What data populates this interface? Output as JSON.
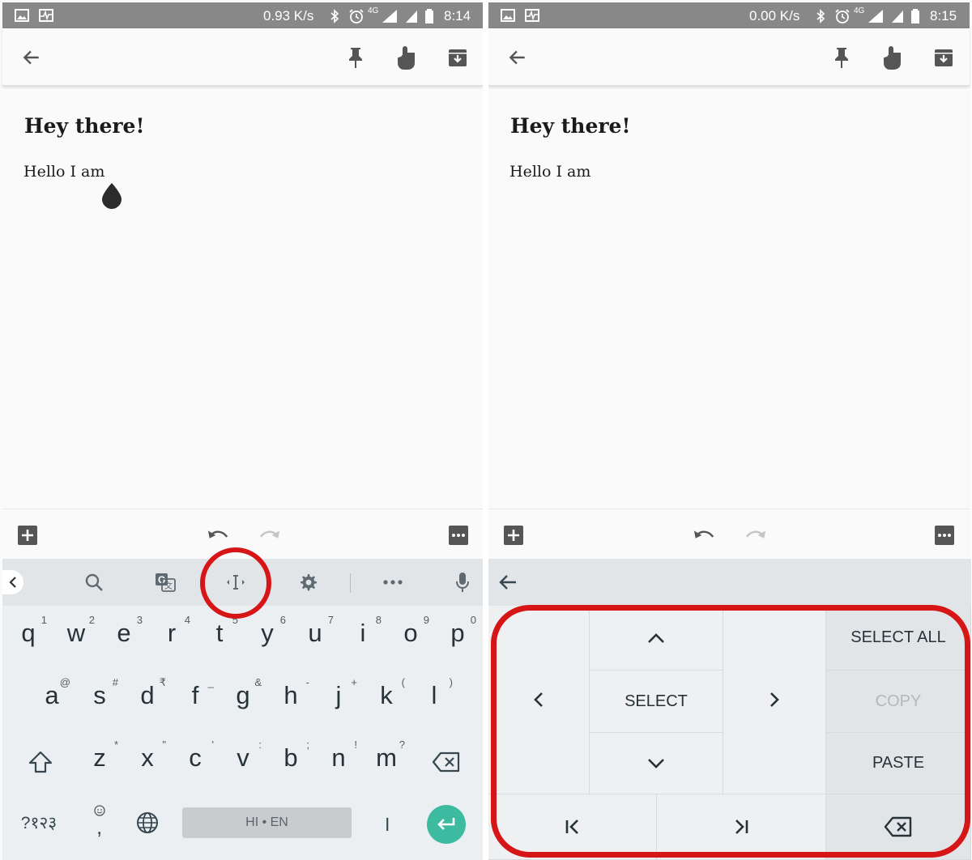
{
  "left_screen": {
    "status_bar": {
      "speed": "0.93 K/s",
      "network": "4G",
      "time": "8:14"
    },
    "note": {
      "title": "Hey there!",
      "body": "Hello I am"
    },
    "keyboard": {
      "row1": [
        {
          "key": "q",
          "hint": "1"
        },
        {
          "key": "w",
          "hint": "2"
        },
        {
          "key": "e",
          "hint": "3"
        },
        {
          "key": "r",
          "hint": "4"
        },
        {
          "key": "t",
          "hint": "5"
        },
        {
          "key": "y",
          "hint": "6"
        },
        {
          "key": "u",
          "hint": "7"
        },
        {
          "key": "i",
          "hint": "8"
        },
        {
          "key": "o",
          "hint": "9"
        },
        {
          "key": "p",
          "hint": "0"
        }
      ],
      "row2": [
        {
          "key": "a",
          "hint": "@"
        },
        {
          "key": "s",
          "hint": "#"
        },
        {
          "key": "d",
          "hint": "₹"
        },
        {
          "key": "f",
          "hint": "_"
        },
        {
          "key": "g",
          "hint": "&"
        },
        {
          "key": "h",
          "hint": "-"
        },
        {
          "key": "j",
          "hint": "+"
        },
        {
          "key": "k",
          "hint": "("
        },
        {
          "key": "l",
          "hint": ")"
        }
      ],
      "row3": [
        {
          "key": "z",
          "hint": "*"
        },
        {
          "key": "x",
          "hint": "\""
        },
        {
          "key": "c",
          "hint": "'"
        },
        {
          "key": "v",
          "hint": ":"
        },
        {
          "key": "b",
          "hint": ";"
        },
        {
          "key": "n",
          "hint": "!"
        },
        {
          "key": "m",
          "hint": "?"
        }
      ],
      "symbols_key": "?१२३",
      "comma_key": ",",
      "space_label": "HI • EN",
      "period_key": "।"
    }
  },
  "right_screen": {
    "status_bar": {
      "speed": "0.00 K/s",
      "network": "4G",
      "time": "8:15"
    },
    "note": {
      "title": "Hey there!",
      "body": "Hello I am"
    },
    "editing_panel": {
      "select_label": "SELECT",
      "select_all_label": "SELECT ALL",
      "copy_label": "COPY",
      "paste_label": "PASTE"
    }
  },
  "icons": {
    "status_bar": [
      "image-icon",
      "pulse-icon",
      "bluetooth-icon",
      "alarm-icon",
      "signal-icon",
      "battery-icon"
    ],
    "app_bar": [
      "back-arrow-icon",
      "pin-icon",
      "reminder-icon",
      "archive-icon"
    ],
    "note_toolbar": [
      "add-box-icon",
      "undo-icon",
      "redo-icon",
      "more-icon"
    ],
    "keyboard_strip": [
      "chevron-left-icon",
      "search-icon",
      "translate-icon",
      "text-editing-icon",
      "settings-icon",
      "more-icon",
      "mic-icon"
    ]
  },
  "colors": {
    "status_bar": "#888888",
    "highlight": "#d61517",
    "enter_key": "#3dbba0",
    "keyboard_bg": "#eceff1"
  }
}
